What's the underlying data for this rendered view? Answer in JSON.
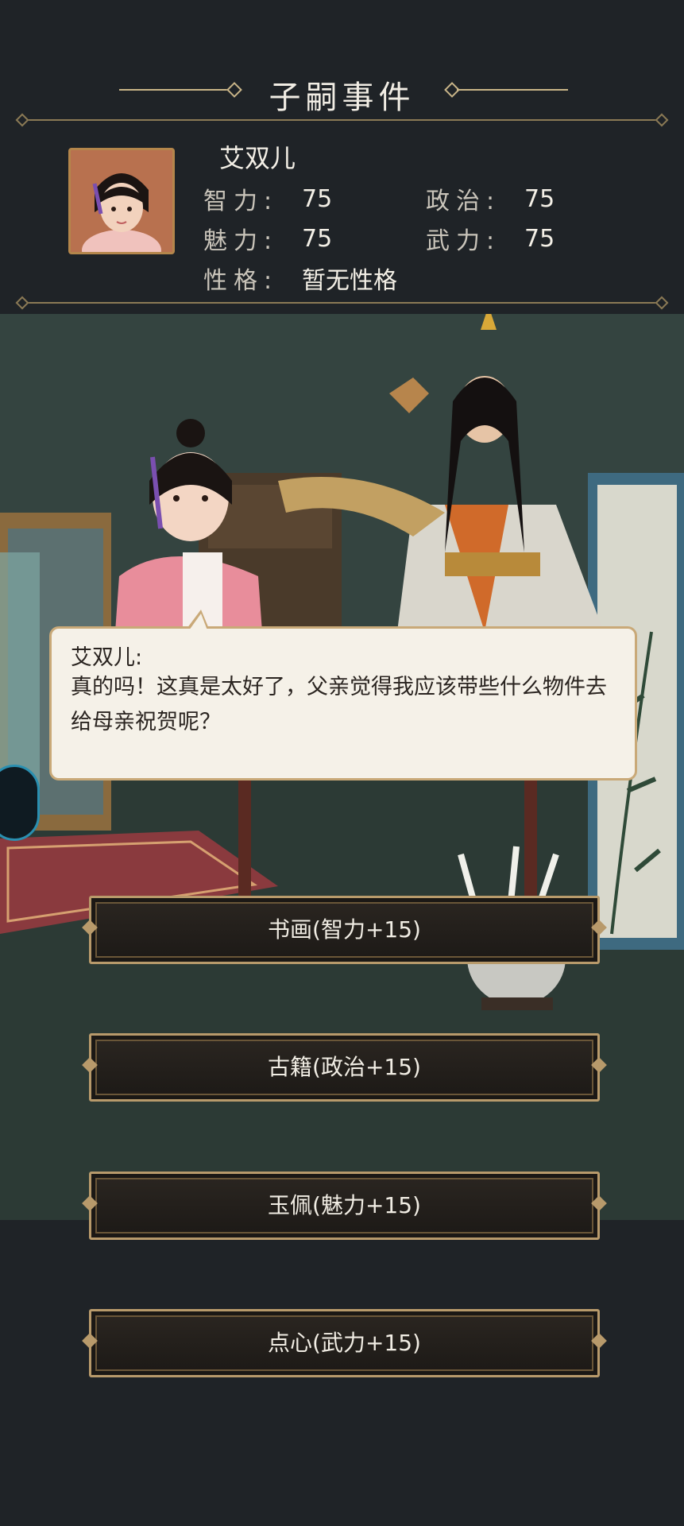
{
  "header": {
    "title": "子嗣事件"
  },
  "profile": {
    "name": "艾双儿",
    "stats": {
      "intelligence": {
        "label": "智力:",
        "value": "75"
      },
      "politics": {
        "label": "政治:",
        "value": "75"
      },
      "charm": {
        "label": "魅力:",
        "value": "75"
      },
      "force": {
        "label": "武力:",
        "value": "75"
      },
      "personality": {
        "label": "性格:",
        "value": "暂无性格"
      }
    }
  },
  "dialogue": {
    "speaker": "艾双儿:",
    "text": "真的吗！这真是太好了，父亲觉得我应该带些什么物件去给母亲祝贺呢？"
  },
  "choices": [
    {
      "label": "书画(智力+15)"
    },
    {
      "label": "古籍(政治+15)"
    },
    {
      "label": "玉佩(魅力+15)"
    },
    {
      "label": "点心(武力+15)"
    }
  ],
  "colors": {
    "background": "#1f2327",
    "gold": "#c9b588",
    "dialog_bg": "#f5f1e8",
    "button_border": "#b89a6b"
  },
  "icons": [
    "portrait-image",
    "child-character",
    "father-character",
    "scroll-pot",
    "side-badge-icon"
  ]
}
